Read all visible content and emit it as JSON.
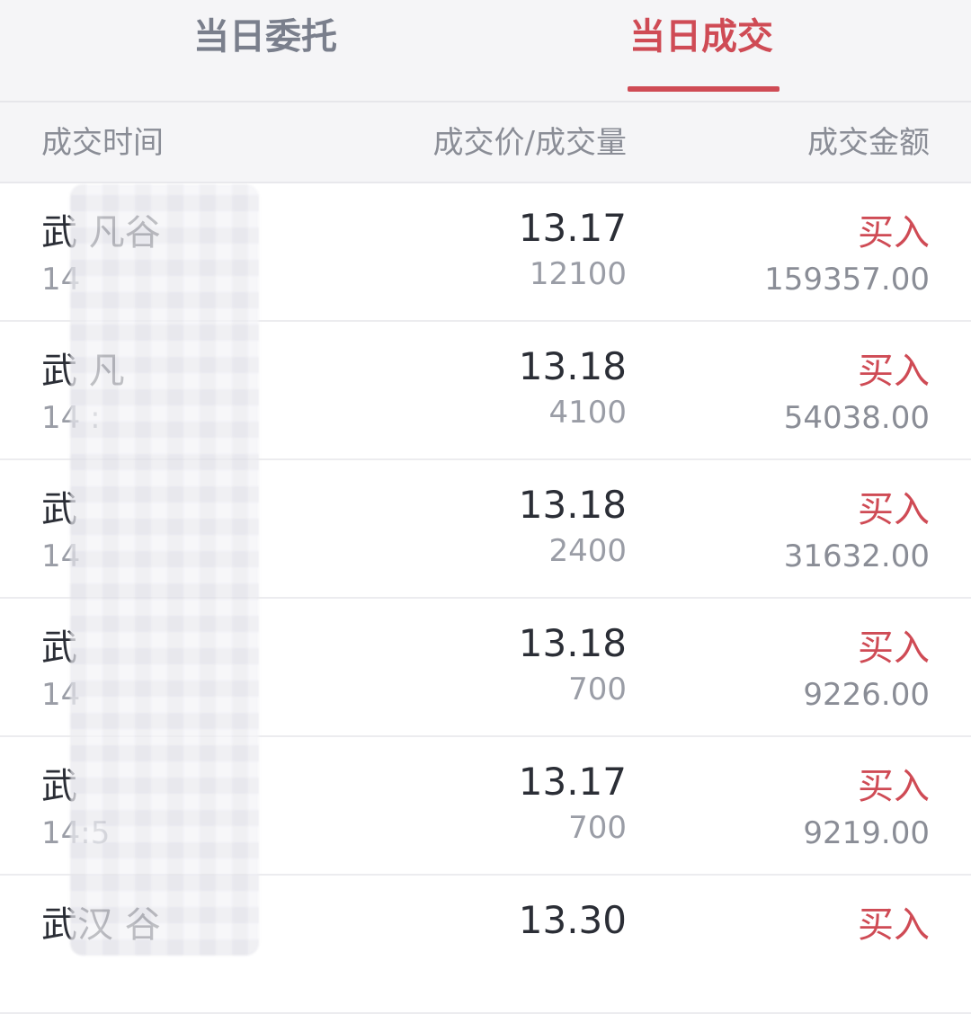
{
  "tabs": [
    {
      "label": "当日委托",
      "active": false
    },
    {
      "label": "当日成交",
      "active": true
    }
  ],
  "columns": {
    "time": "成交时间",
    "price_qty": "成交价/成交量",
    "amount": "成交金额"
  },
  "rows": [
    {
      "name": "武  凡谷",
      "time": "14",
      "price": "13.17",
      "qty": "12100",
      "side": "买入",
      "amount": "159357.00"
    },
    {
      "name": "武  凡",
      "time": "14  :",
      "price": "13.18",
      "qty": "4100",
      "side": "买入",
      "amount": "54038.00"
    },
    {
      "name": "武",
      "time": "14",
      "price": "13.18",
      "qty": "2400",
      "side": "买入",
      "amount": "31632.00"
    },
    {
      "name": "武",
      "time": "14",
      "price": "13.18",
      "qty": "700",
      "side": "买入",
      "amount": "9226.00"
    },
    {
      "name": "武",
      "time": "14:5",
      "price": "13.17",
      "qty": "700",
      "side": "买入",
      "amount": "9219.00"
    },
    {
      "name": "武汉  谷",
      "time": "",
      "price": "13.30",
      "qty": "",
      "side": "买入",
      "amount": ""
    }
  ],
  "colors": {
    "accent": "#cf4b55",
    "header_bg": "#f5f5f7"
  }
}
